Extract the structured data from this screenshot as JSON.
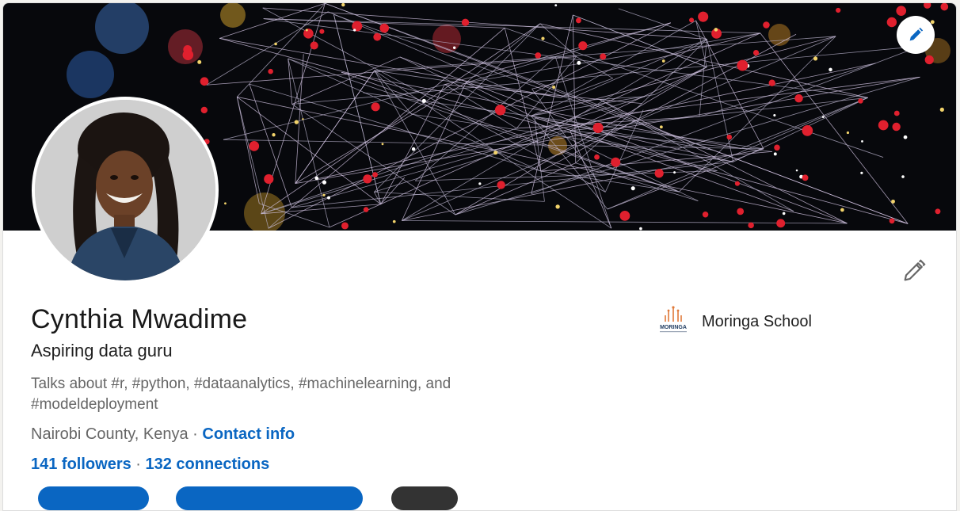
{
  "profile": {
    "name": "Cynthia Mwadime",
    "headline": "Aspiring data guru",
    "talks_about": "Talks about #r, #python, #dataanalytics, #machinelearning, and #modeldeployment",
    "location": "Nairobi County, Kenya",
    "location_separator": " · ",
    "contact_info_label": "Contact info",
    "followers_label": "141 followers",
    "network_separator": " · ",
    "connections_label": "132 connections"
  },
  "organization": {
    "name": "Moringa School",
    "logo_text": "MORINGA"
  },
  "icons": {
    "cover_edit": "pencil-icon",
    "intro_edit": "pencil-icon"
  },
  "colors": {
    "link": "#0a66c2",
    "primary_text": "#191919",
    "secondary_text": "#666666",
    "background": "#f3f2ef",
    "card": "#ffffff"
  }
}
